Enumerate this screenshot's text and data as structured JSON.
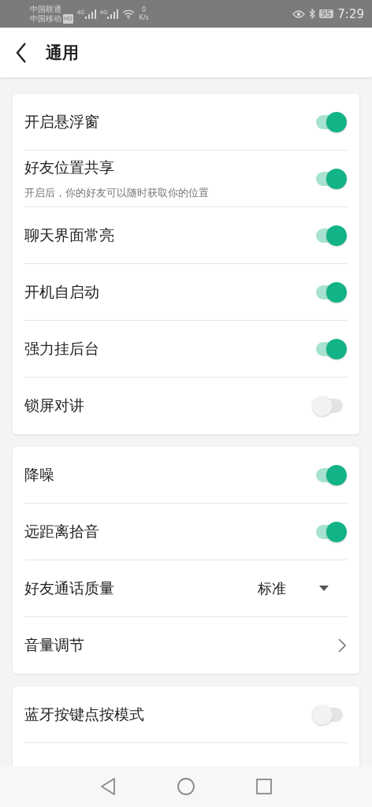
{
  "status_bar": {
    "carrier_1": "中国联通",
    "carrier_2": "中国移动",
    "hd_badge": "HD",
    "network_1": "4G",
    "network_2": "4G",
    "speed_value": "0",
    "speed_unit": "K/s",
    "battery": "95",
    "time": "7:29"
  },
  "header": {
    "title": "通用"
  },
  "cards": [
    {
      "items": [
        {
          "kind": "toggle",
          "label": "开启悬浮窗",
          "on": true
        },
        {
          "kind": "toggle",
          "label": "好友位置共享",
          "description": "开启后，你的好友可以随时获取你的位置",
          "on": true
        },
        {
          "kind": "toggle",
          "label": "聊天界面常亮",
          "on": true
        },
        {
          "kind": "toggle",
          "label": "开机自启动",
          "on": true
        },
        {
          "kind": "toggle",
          "label": "强力挂后台",
          "on": true
        },
        {
          "kind": "toggle",
          "label": "锁屏对讲",
          "on": false
        }
      ]
    },
    {
      "items": [
        {
          "kind": "toggle",
          "label": "降噪",
          "on": true
        },
        {
          "kind": "toggle",
          "label": "远距离拾音",
          "on": true
        },
        {
          "kind": "select",
          "label": "好友通话质量",
          "value": "标准"
        },
        {
          "kind": "link",
          "label": "音量调节"
        }
      ]
    },
    {
      "items": [
        {
          "kind": "toggle",
          "label": "蓝牙按键点按模式",
          "on": false
        }
      ]
    }
  ]
}
